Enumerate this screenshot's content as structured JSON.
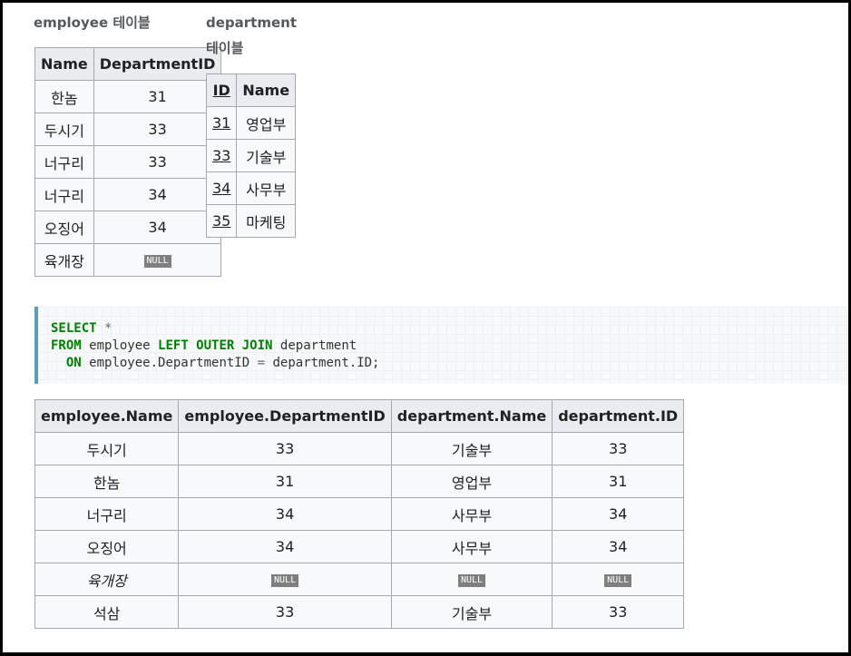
{
  "emp_caption": "employee 테이블",
  "dept_caption_1": "department",
  "dept_caption_2": "테이블",
  "employee": {
    "headers": [
      "Name",
      "DepartmentID"
    ],
    "rows": [
      {
        "name": "한놈",
        "dept": "31"
      },
      {
        "name": "두시기",
        "dept": "33"
      },
      {
        "name": "너구리",
        "dept": "33"
      },
      {
        "name": "너구리",
        "dept": "34"
      },
      {
        "name": "오징어",
        "dept": "34"
      },
      {
        "name": "육개장",
        "dept": "NULL"
      }
    ]
  },
  "department": {
    "headers": [
      "ID",
      "Name"
    ],
    "rows": [
      {
        "id": "31",
        "name": "영업부"
      },
      {
        "id": "33",
        "name": "기술부"
      },
      {
        "id": "34",
        "name": "사무부"
      },
      {
        "id": "35",
        "name": "마케팅"
      }
    ]
  },
  "sql": {
    "select": "SELECT",
    "star": "*",
    "from": "FROM",
    "table1": "employee",
    "join": "LEFT OUTER JOIN",
    "table2": "department",
    "on": "ON",
    "lhs": "employee.DepartmentID",
    "eq": "=",
    "rhs": "department.ID;"
  },
  "result": {
    "headers": [
      "employee.Name",
      "employee.DepartmentID",
      "department.Name",
      "department.ID"
    ],
    "rows": [
      {
        "c1": "두시기",
        "c2": "33",
        "c3": "기술부",
        "c4": "33"
      },
      {
        "c1": "한놈",
        "c2": "31",
        "c3": "영업부",
        "c4": "31"
      },
      {
        "c1": "너구리",
        "c2": "34",
        "c3": "사무부",
        "c4": "34"
      },
      {
        "c1": "오징어",
        "c2": "34",
        "c3": "사무부",
        "c4": "34"
      },
      {
        "c1": "육개장",
        "c2": "NULL",
        "c3": "NULL",
        "c4": "NULL"
      },
      {
        "c1": "석삼",
        "c2": "33",
        "c3": "기술부",
        "c4": "33"
      }
    ]
  }
}
